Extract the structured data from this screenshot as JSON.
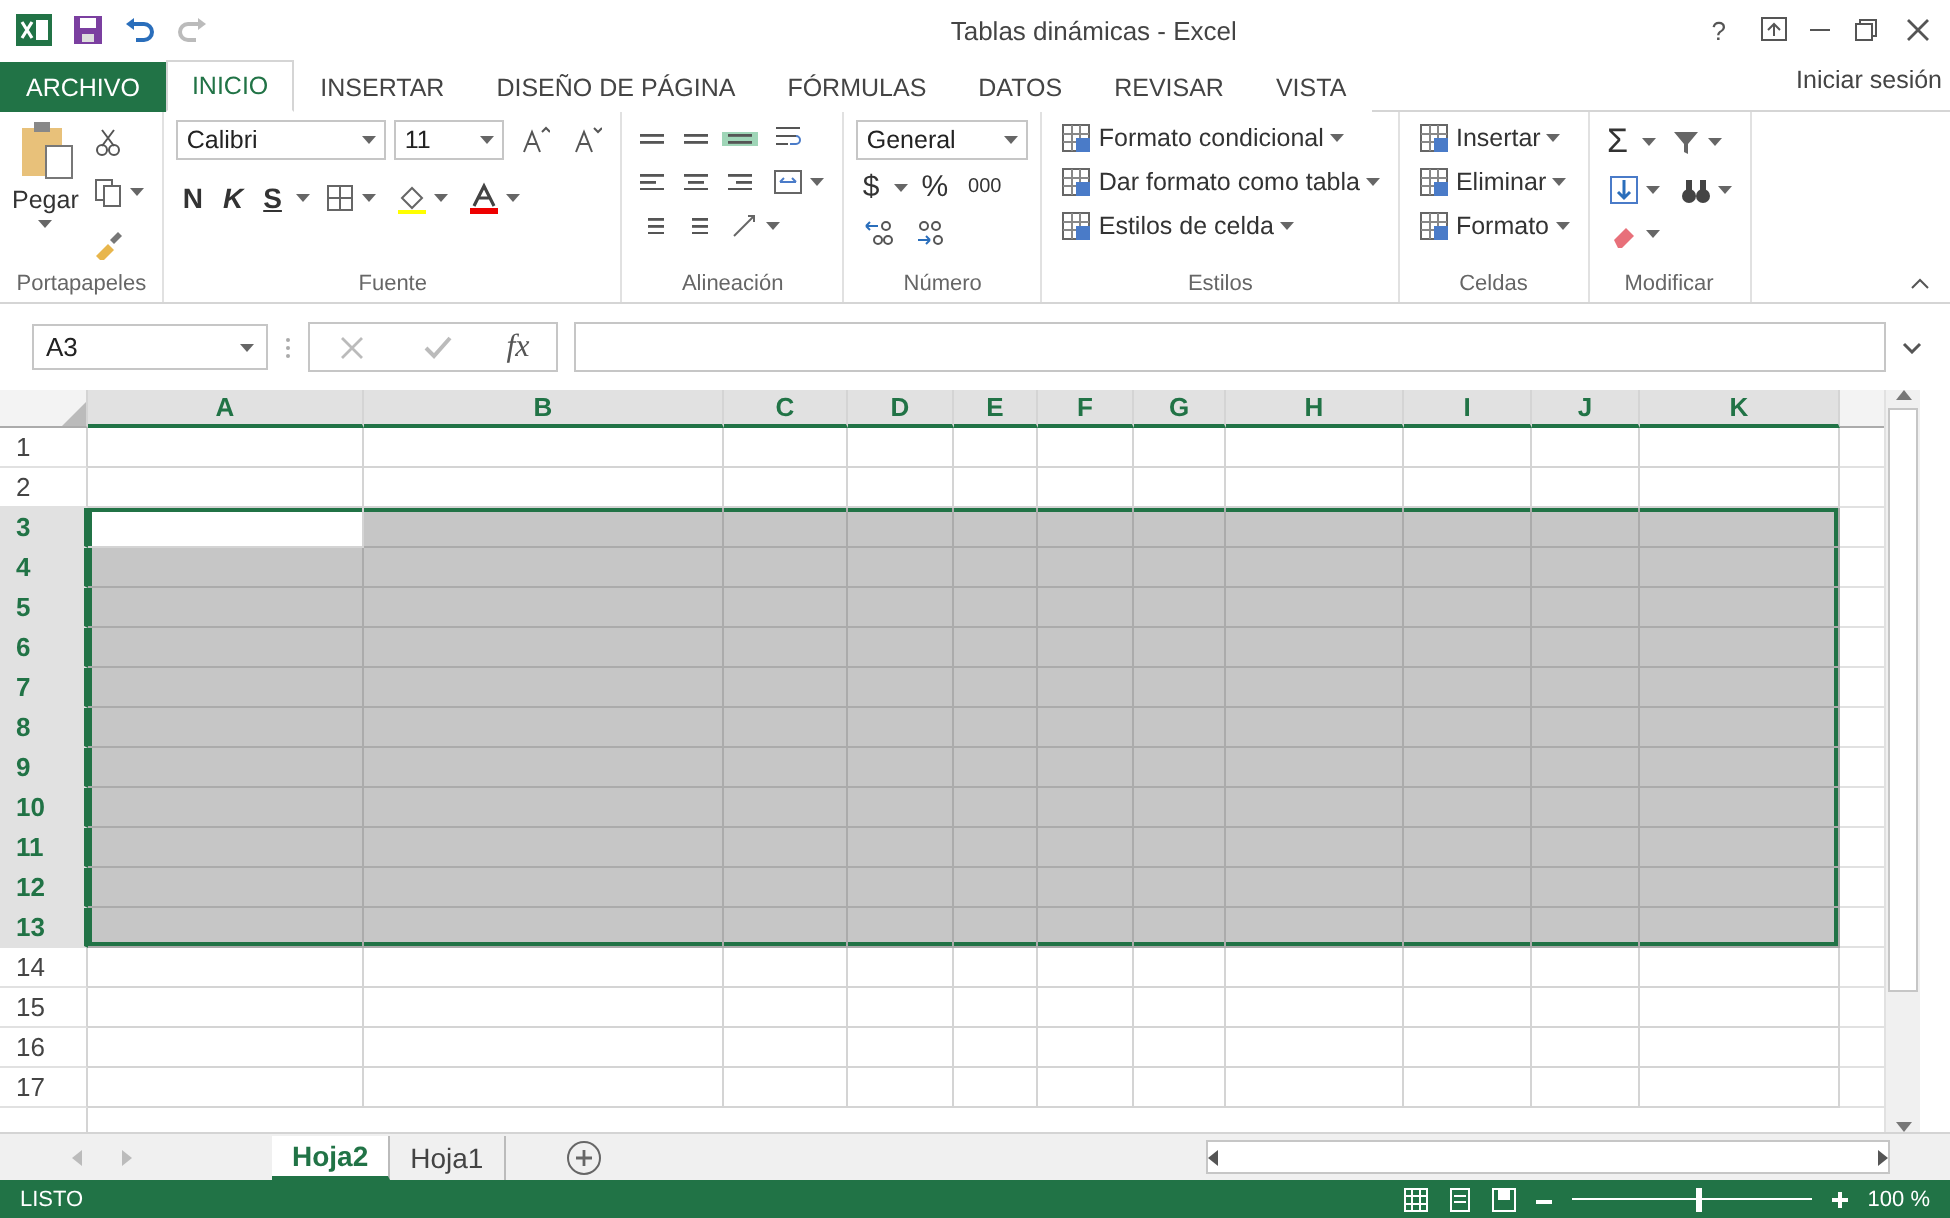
{
  "window": {
    "title": "Tablas dinámicas - Excel",
    "help": "?"
  },
  "ribbon_tabs": [
    {
      "label": "ARCHIVO",
      "kind": "file",
      "selected": false
    },
    {
      "label": "INICIO",
      "kind": "tab",
      "selected": true
    },
    {
      "label": "INSERTAR",
      "kind": "tab",
      "selected": false
    },
    {
      "label": "DISEÑO DE PÁGINA",
      "kind": "tab",
      "selected": false
    },
    {
      "label": "FÓRMULAS",
      "kind": "tab",
      "selected": false
    },
    {
      "label": "DATOS",
      "kind": "tab",
      "selected": false
    },
    {
      "label": "REVISAR",
      "kind": "tab",
      "selected": false
    },
    {
      "label": "VISTA",
      "kind": "tab",
      "selected": false
    }
  ],
  "sign_in": "Iniciar sesión",
  "ribbon_groups": [
    {
      "kind": "clipboard",
      "label": "Portapapeles",
      "paste": "Pegar"
    },
    {
      "kind": "font",
      "label": "Fuente",
      "font": "Calibri",
      "size": "11",
      "bold": "N",
      "italic": "K",
      "underline": "S"
    },
    {
      "kind": "align",
      "label": "Alineación",
      "vertical_align": [
        {
          "selected": false
        },
        {
          "selected": false
        },
        {
          "selected": true
        }
      ]
    },
    {
      "kind": "number",
      "label": "Número",
      "format": "General",
      "currency": "$",
      "percent": "%",
      "thousands": "000"
    },
    {
      "kind": "commands",
      "label": "Estilos",
      "commands": [
        "Formato condicional",
        "Dar formato como tabla",
        "Estilos de celda"
      ]
    },
    {
      "kind": "commands",
      "label": "Celdas",
      "commands": [
        "Insertar",
        "Eliminar",
        "Formato"
      ]
    },
    {
      "kind": "edit",
      "label": "Modificar",
      "sum": "Σ"
    }
  ],
  "formula_bar": {
    "name_box": "A3",
    "fx": "fx"
  },
  "columns": [
    {
      "label": "A",
      "selected": true,
      "active": true
    },
    {
      "label": "B",
      "selected": true,
      "active": false
    },
    {
      "label": "C",
      "selected": true,
      "active": false
    },
    {
      "label": "D",
      "selected": true,
      "active": false
    },
    {
      "label": "E",
      "selected": true,
      "active": false
    },
    {
      "label": "F",
      "selected": true,
      "active": false
    },
    {
      "label": "G",
      "selected": true,
      "active": false
    },
    {
      "label": "H",
      "selected": true,
      "active": false
    },
    {
      "label": "I",
      "selected": true,
      "active": false
    },
    {
      "label": "J",
      "selected": true,
      "active": false
    },
    {
      "label": "K",
      "selected": true,
      "active": false
    }
  ],
  "rows": [
    {
      "label": "1",
      "selected": false,
      "active": false
    },
    {
      "label": "2",
      "selected": false,
      "active": false
    },
    {
      "label": "3",
      "selected": true,
      "active": true
    },
    {
      "label": "4",
      "selected": true,
      "active": false
    },
    {
      "label": "5",
      "selected": true,
      "active": false
    },
    {
      "label": "6",
      "selected": true,
      "active": false
    },
    {
      "label": "7",
      "selected": true,
      "active": false
    },
    {
      "label": "8",
      "selected": true,
      "active": false
    },
    {
      "label": "9",
      "selected": true,
      "active": false
    },
    {
      "label": "10",
      "selected": true,
      "active": false
    },
    {
      "label": "11",
      "selected": true,
      "active": false
    },
    {
      "label": "12",
      "selected": true,
      "active": false
    },
    {
      "label": "13",
      "selected": true,
      "active": false
    },
    {
      "label": "14",
      "selected": false,
      "active": false
    },
    {
      "label": "15",
      "selected": false,
      "active": false
    },
    {
      "label": "16",
      "selected": false,
      "active": false
    },
    {
      "label": "17",
      "selected": false,
      "active": false
    }
  ],
  "sheet_tabs": [
    {
      "label": "Hoja2",
      "selected": true
    },
    {
      "label": "Hoja1",
      "selected": false
    }
  ],
  "status_bar": {
    "status": "LISTO",
    "zoom": "100 %",
    "zoom_slider": {
      "level": 0.52
    }
  }
}
